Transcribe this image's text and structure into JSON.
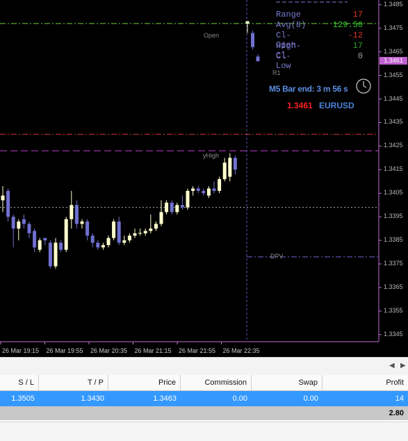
{
  "info_panel": {
    "rows": [
      {
        "label": "Range",
        "value": "17",
        "color": "#e03030"
      },
      {
        "label": " Avg(8)",
        "value": "129.50",
        "color": "#30d030"
      },
      {
        "label": "Cl-Open",
        "value": "-12",
        "color": "#e03030"
      },
      {
        "label": "High-Cl",
        "value": "17",
        "color": "#30a030"
      },
      {
        "label": "Cl-Low",
        "value": "0",
        "color": "#a0a0a0"
      }
    ],
    "r1_label": "R1",
    "bar_end": "M5 Bar end: 3 m 56 s",
    "price": "1.3461",
    "symbol": "EURUSD",
    "clock_icon": "clock-icon"
  },
  "chart_labels": {
    "open": "Open",
    "yhigh": "yHigh",
    "dpv": "DPV"
  },
  "price_axis": {
    "ticks": [
      "1.3485",
      "1.3475",
      "1.3465",
      "1.3455",
      "1.3445",
      "1.3435",
      "1.3425",
      "1.3415",
      "1.3405",
      "1.3395",
      "1.3385",
      "1.3375",
      "1.3365",
      "1.3355",
      "1.3345"
    ],
    "current_price": "1.3461"
  },
  "time_axis": {
    "ticks": [
      "26 Mar 19:15",
      "26 Mar 19:55",
      "26 Mar 20:35",
      "26 Mar 21:15",
      "26 Mar 21:55",
      "26 Mar 22:35"
    ]
  },
  "chart_data": {
    "type": "candlestick",
    "ylim": [
      1.3342,
      1.3487
    ],
    "candles": [
      {
        "o": 1.3402,
        "h": 1.3408,
        "l": 1.3397,
        "c": 1.3404
      },
      {
        "o": 1.3406,
        "h": 1.3407,
        "l": 1.3393,
        "c": 1.3395
      },
      {
        "o": 1.3395,
        "h": 1.3396,
        "l": 1.3382,
        "c": 1.339
      },
      {
        "o": 1.339,
        "h": 1.3394,
        "l": 1.3385,
        "c": 1.3393
      },
      {
        "o": 1.3394,
        "h": 1.3396,
        "l": 1.339,
        "c": 1.3392
      },
      {
        "o": 1.3392,
        "h": 1.3393,
        "l": 1.3386,
        "c": 1.3388
      },
      {
        "o": 1.3389,
        "h": 1.339,
        "l": 1.338,
        "c": 1.3382
      },
      {
        "o": 1.3381,
        "h": 1.3386,
        "l": 1.338,
        "c": 1.3385
      },
      {
        "o": 1.3386,
        "h": 1.3386,
        "l": 1.3383,
        "c": 1.3385
      },
      {
        "o": 1.3384,
        "h": 1.3385,
        "l": 1.3373,
        "c": 1.3374
      },
      {
        "o": 1.3374,
        "h": 1.3386,
        "l": 1.3373,
        "c": 1.3384
      },
      {
        "o": 1.3384,
        "h": 1.3385,
        "l": 1.338,
        "c": 1.3381
      },
      {
        "o": 1.3381,
        "h": 1.3395,
        "l": 1.338,
        "c": 1.3394
      },
      {
        "o": 1.3394,
        "h": 1.3406,
        "l": 1.339,
        "c": 1.34
      },
      {
        "o": 1.34,
        "h": 1.3402,
        "l": 1.339,
        "c": 1.3392
      },
      {
        "o": 1.3392,
        "h": 1.3394,
        "l": 1.339,
        "c": 1.3393
      },
      {
        "o": 1.3393,
        "h": 1.3394,
        "l": 1.3385,
        "c": 1.3387
      },
      {
        "o": 1.3387,
        "h": 1.3388,
        "l": 1.3382,
        "c": 1.3384
      },
      {
        "o": 1.3384,
        "h": 1.3385,
        "l": 1.3381,
        "c": 1.3382
      },
      {
        "o": 1.3382,
        "h": 1.3384,
        "l": 1.3381,
        "c": 1.3383
      },
      {
        "o": 1.3383,
        "h": 1.3387,
        "l": 1.3382,
        "c": 1.3386
      },
      {
        "o": 1.3386,
        "h": 1.3394,
        "l": 1.3385,
        "c": 1.3393
      },
      {
        "o": 1.3393,
        "h": 1.3395,
        "l": 1.3383,
        "c": 1.3384
      },
      {
        "o": 1.3384,
        "h": 1.3387,
        "l": 1.3383,
        "c": 1.3385
      },
      {
        "o": 1.3385,
        "h": 1.3388,
        "l": 1.3384,
        "c": 1.3387
      },
      {
        "o": 1.3387,
        "h": 1.339,
        "l": 1.3386,
        "c": 1.3388
      },
      {
        "o": 1.3388,
        "h": 1.339,
        "l": 1.3387,
        "c": 1.3388
      },
      {
        "o": 1.3388,
        "h": 1.339,
        "l": 1.3387,
        "c": 1.3389
      },
      {
        "o": 1.3389,
        "h": 1.3396,
        "l": 1.3388,
        "c": 1.339
      },
      {
        "o": 1.339,
        "h": 1.3393,
        "l": 1.3389,
        "c": 1.3392
      },
      {
        "o": 1.3392,
        "h": 1.3402,
        "l": 1.3391,
        "c": 1.3397
      },
      {
        "o": 1.3397,
        "h": 1.3402,
        "l": 1.3396,
        "c": 1.3401
      },
      {
        "o": 1.3401,
        "h": 1.3402,
        "l": 1.3396,
        "c": 1.3397
      },
      {
        "o": 1.3397,
        "h": 1.3401,
        "l": 1.3396,
        "c": 1.34
      },
      {
        "o": 1.34,
        "h": 1.3404,
        "l": 1.3398,
        "c": 1.3399
      },
      {
        "o": 1.3399,
        "h": 1.3407,
        "l": 1.3398,
        "c": 1.3406
      },
      {
        "o": 1.3406,
        "h": 1.3408,
        "l": 1.3404,
        "c": 1.3407
      },
      {
        "o": 1.3407,
        "h": 1.3408,
        "l": 1.3405,
        "c": 1.3406
      },
      {
        "o": 1.3406,
        "h": 1.3407,
        "l": 1.3404,
        "c": 1.3405
      },
      {
        "o": 1.3404,
        "h": 1.3408,
        "l": 1.3403,
        "c": 1.3407
      },
      {
        "o": 1.3407,
        "h": 1.341,
        "l": 1.3405,
        "c": 1.3406
      },
      {
        "o": 1.3406,
        "h": 1.3412,
        "l": 1.3405,
        "c": 1.3411
      },
      {
        "o": 1.3411,
        "h": 1.342,
        "l": 1.341,
        "c": 1.3418
      },
      {
        "o": 1.3412,
        "h": 1.3422,
        "l": 1.341,
        "c": 1.342
      },
      {
        "o": 1.342,
        "h": 1.3421,
        "l": 1.3413,
        "c": 1.3415
      }
    ],
    "live_candles": [
      {
        "o": 1.3477,
        "h": 1.3478,
        "l": 1.3473,
        "c": 1.3478
      },
      {
        "o": 1.3473,
        "h": 1.3474,
        "l": 1.3466,
        "c": 1.3467
      },
      {
        "o": 1.3463,
        "h": 1.3464,
        "l": 1.3461,
        "c": 1.3461
      }
    ],
    "levels": [
      {
        "name": "Open",
        "value": 1.3477,
        "color": "#6ccf3c",
        "style": "dashdot"
      },
      {
        "name": "R1",
        "value": 1.343,
        "color": "#d23636",
        "style": "dashdot"
      },
      {
        "name": "yHigh",
        "value": 1.3423,
        "color": "#c040d0",
        "style": "dashed"
      },
      {
        "name": "pivot",
        "value": 1.3399,
        "color": "#b0b0b0",
        "style": "dotted"
      },
      {
        "name": "DPV",
        "value": 1.3378,
        "color": "#6a6ad0",
        "style": "dashdot"
      }
    ],
    "bull_color": "#ffffcc",
    "bear_color": "#7070d0"
  },
  "trade_table": {
    "columns": [
      "S / L",
      "T / P",
      "Price",
      "Commission",
      "Swap",
      "Profit"
    ],
    "row": [
      "1.3505",
      "1.3430",
      "1.3463",
      "0.00",
      "0.00",
      "14"
    ],
    "total": "2.80"
  }
}
